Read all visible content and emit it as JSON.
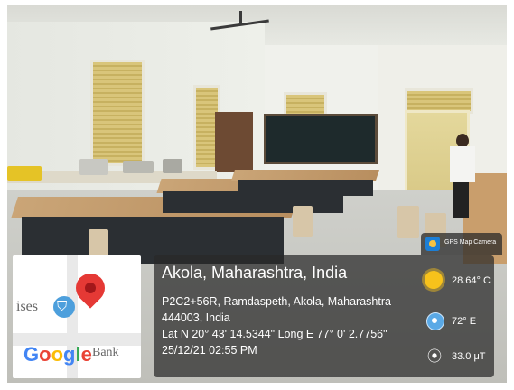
{
  "photo": {
    "description_icons": [
      "ceiling-fan-icon",
      "blackboard-icon",
      "window-icon",
      "door-icon"
    ]
  },
  "map": {
    "text_left": "ises",
    "text_bank": "Bank",
    "google_letters": [
      "G",
      "o",
      "o",
      "g",
      "l",
      "e"
    ],
    "google_colors": [
      "#4285F4",
      "#EA4335",
      "#FBBC05",
      "#4285F4",
      "#34A853",
      "#EA4335"
    ],
    "pin_icon": "map-pin-icon",
    "cart_icon": "shopping-cart-icon"
  },
  "badge": {
    "label": "GPS Map Camera",
    "icon": "gps-map-camera-icon"
  },
  "location": {
    "city": "Akola, Maharashtra, India",
    "address_line1": "P2C2+56R, Ramdaspeth, Akola, Maharashtra",
    "address_line2": "444003, India",
    "coordinates": "Lat N 20° 43' 14.5344\" Long E 77° 0' 2.7756\"",
    "datetime": "25/12/21 02:55 PM"
  },
  "metrics": {
    "temperature": "28.64° C",
    "wind": "72° E",
    "magnetic": "33.0 μT",
    "temperature_icon": "sun-icon",
    "wind_icon": "wind-icon",
    "magnetic_icon": "magnet-icon"
  },
  "colors": {
    "panel_bg": "#282828",
    "pin_red": "#e53935",
    "sun_yellow": "#f7c21b",
    "wind_blue": "#5aa9e6"
  }
}
